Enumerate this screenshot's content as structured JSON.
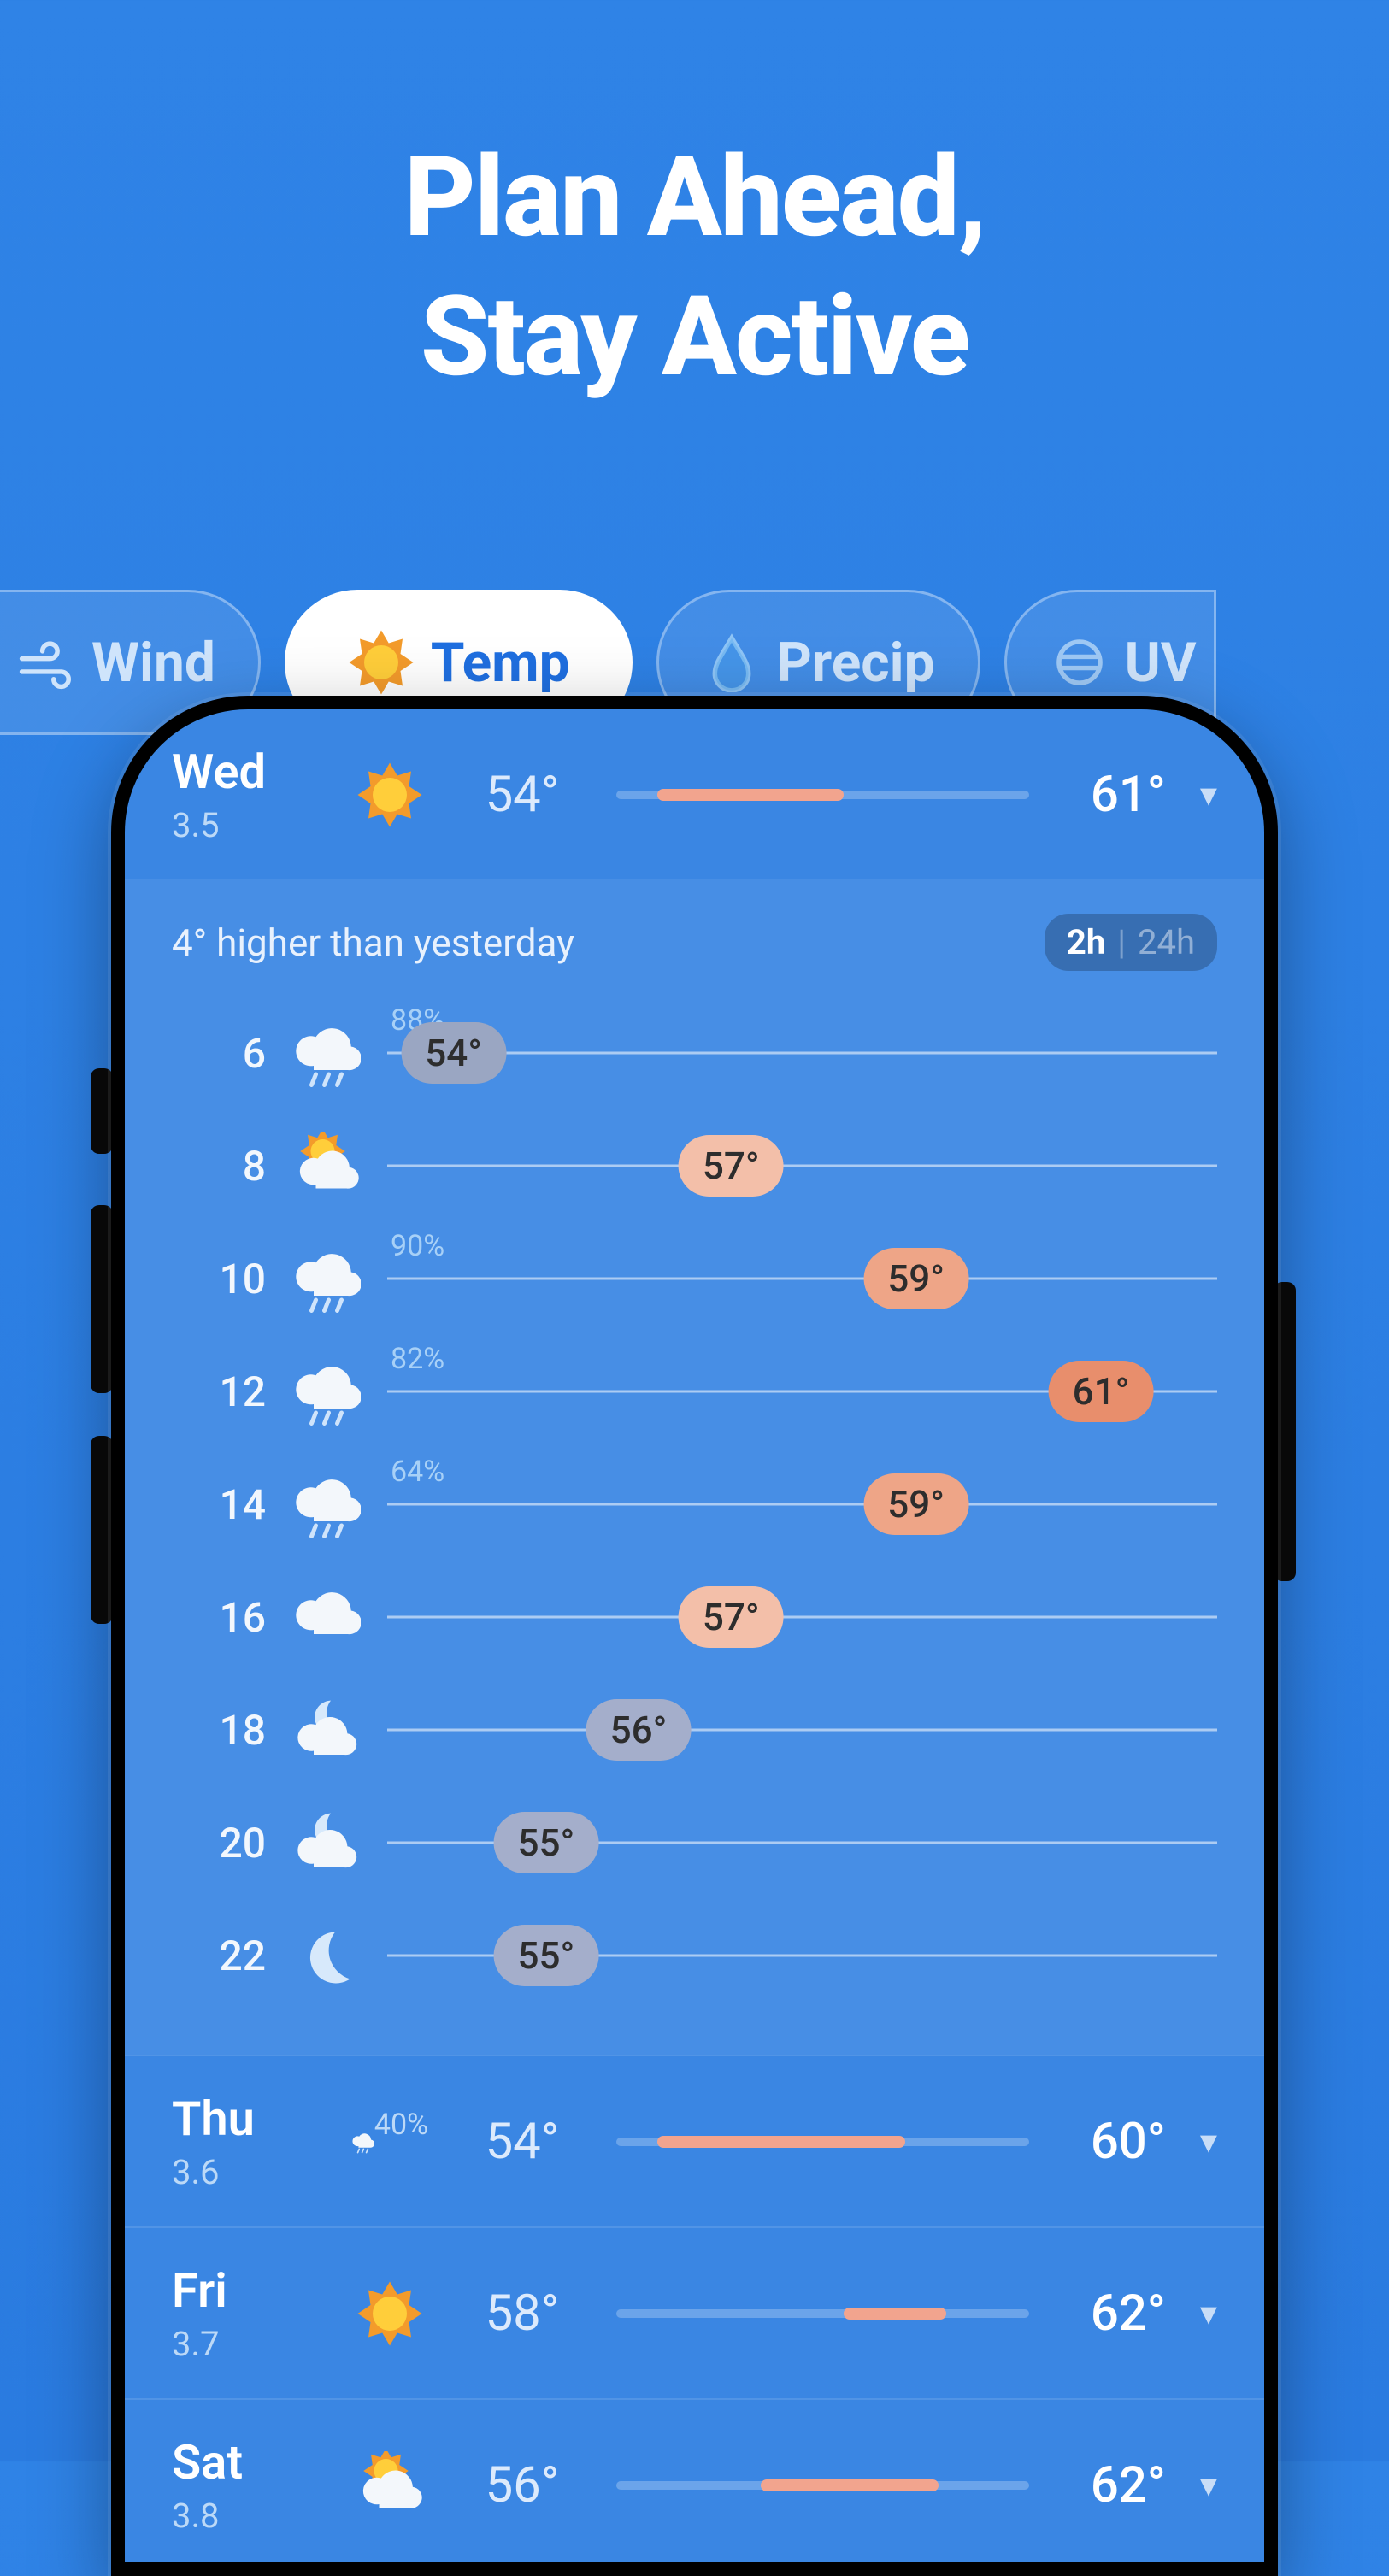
{
  "hero": {
    "line1": "Plan Ahead,",
    "line2": "Stay Active"
  },
  "tabs": [
    {
      "id": "wind",
      "label": "Wind",
      "icon": "wind-icon",
      "active": false
    },
    {
      "id": "temp",
      "label": "Temp",
      "icon": "sun-icon",
      "active": true
    },
    {
      "id": "precip",
      "label": "Precip",
      "icon": "droplet-icon",
      "active": false
    },
    {
      "id": "uv",
      "label": "UV",
      "icon": "uv-icon",
      "active": false
    }
  ],
  "expanded_day": {
    "day": "Wed",
    "date": "3.5",
    "icon": "sun",
    "low": "54°",
    "high": "61°",
    "bar": {
      "start": 0.1,
      "end": 0.55
    },
    "note": "4° higher than yesterday",
    "toggle": {
      "selected": "2h",
      "other": "24h"
    },
    "temp_min": 54,
    "temp_max": 61,
    "hours": [
      {
        "h": "6",
        "icon": "rain",
        "pct": "88%",
        "t": 54,
        "label": "54°",
        "shade": "cold"
      },
      {
        "h": "8",
        "icon": "sun-cloud",
        "pct": "",
        "t": 57,
        "label": "57°",
        "shade": "warm1"
      },
      {
        "h": "10",
        "icon": "rain",
        "pct": "90%",
        "t": 59,
        "label": "59°",
        "shade": "warm2"
      },
      {
        "h": "12",
        "icon": "rain",
        "pct": "82%",
        "t": 61,
        "label": "61°",
        "shade": "warm3"
      },
      {
        "h": "14",
        "icon": "rain",
        "pct": "64%",
        "t": 59,
        "label": "59°",
        "shade": "warm2"
      },
      {
        "h": "16",
        "icon": "cloud",
        "pct": "",
        "t": 57,
        "label": "57°",
        "shade": "warm1"
      },
      {
        "h": "18",
        "icon": "night-cloud",
        "pct": "",
        "t": 56,
        "label": "56°",
        "shade": "cool"
      },
      {
        "h": "20",
        "icon": "night-cloud",
        "pct": "",
        "t": 55,
        "label": "55°",
        "shade": "cool"
      },
      {
        "h": "22",
        "icon": "moon",
        "pct": "",
        "t": 55,
        "label": "55°",
        "shade": "cool"
      }
    ]
  },
  "days": [
    {
      "day": "Thu",
      "date": "3.6",
      "icon": "rain",
      "sub": "40%",
      "low": "54°",
      "high": "60°",
      "bar": {
        "start": 0.1,
        "end": 0.7
      }
    },
    {
      "day": "Fri",
      "date": "3.7",
      "icon": "sun",
      "sub": "",
      "low": "58°",
      "high": "62°",
      "bar": {
        "start": 0.55,
        "end": 0.8
      }
    },
    {
      "day": "Sat",
      "date": "3.8",
      "icon": "sun-cloud",
      "sub": "",
      "low": "56°",
      "high": "62°",
      "bar": {
        "start": 0.35,
        "end": 0.78
      }
    }
  ],
  "colors": {
    "pill": {
      "cold": "#9aa6c2",
      "cool": "#a4aecb",
      "warm1": "#f3bfa9",
      "warm2": "#eea587",
      "warm3": "#e88e6c"
    }
  }
}
